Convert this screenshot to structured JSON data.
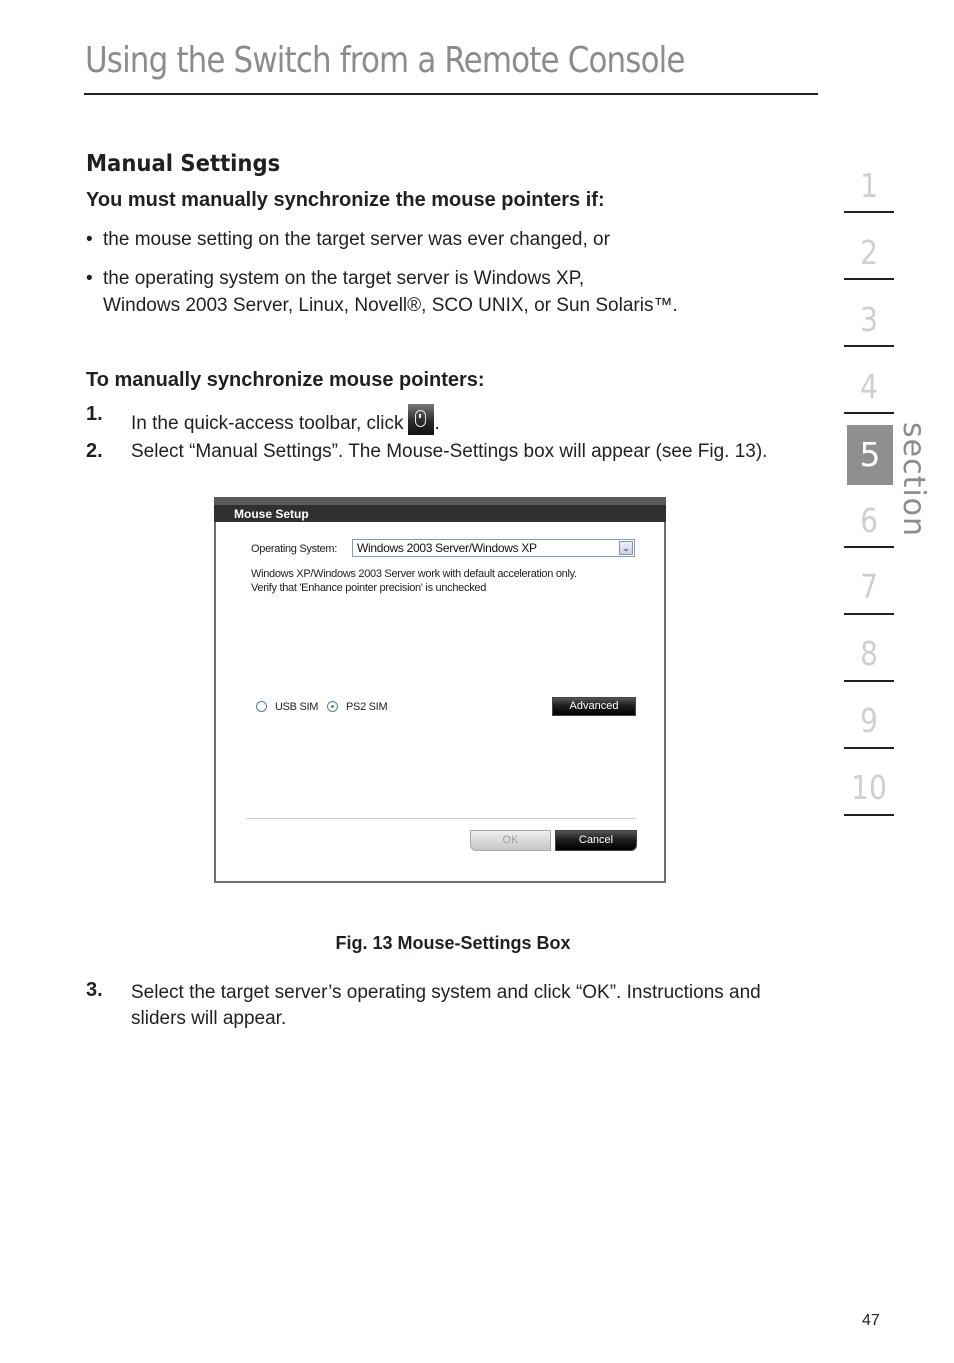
{
  "header": {
    "title": "Using the Switch from a Remote Console"
  },
  "content": {
    "section_heading": "Manual Settings",
    "conditions_heading": "You must manually synchronize the mouse pointers if:",
    "bullets": [
      {
        "lines": [
          "the mouse setting on the target server was ever changed, or"
        ]
      },
      {
        "lines": [
          "the operating system on the target server is Windows XP,",
          "Windows 2003 Server, Linux, Novell®, SCO UNIX, or Sun Solaris™."
        ]
      }
    ],
    "bullet_glyph": "•",
    "procedure_heading": "To manually synchronize mouse pointers:",
    "steps": [
      {
        "number": "1.",
        "text": "In the quick-access toolbar, click",
        "suffix": ".",
        "icon": "mouse-settings-icon"
      },
      {
        "number": "2.",
        "text": "Select “Manual Settings”. The Mouse-Settings box will appear (see Fig. 13)."
      },
      {
        "number": "3.",
        "lines": [
          "Select the target server’s operating system and click “OK”. Instructions and",
          "sliders will appear."
        ]
      }
    ],
    "figure_caption": "Fig. 13 Mouse-Settings Box"
  },
  "dialog": {
    "title": "Mouse Setup",
    "os_label": "Operating System:",
    "os_selected": "Windows 2003 Server/Windows XP",
    "os_dropdown_arrow": "⌄",
    "info_lines": [
      "Windows XP/Windows 2003 Server work with default acceleration only.",
      "Verify that 'Enhance pointer precision' is unchecked"
    ],
    "radio_options": [
      {
        "label": "USB SIM",
        "checked": false
      },
      {
        "label": "PS2 SIM",
        "checked": true
      }
    ],
    "advanced_label": "Advanced",
    "ok_label": "OK",
    "ok_enabled": false,
    "cancel_label": "Cancel"
  },
  "side_nav": {
    "items": [
      "1",
      "2",
      "3",
      "4",
      "5",
      "6",
      "7",
      "8",
      "9",
      "10"
    ],
    "active": "5",
    "label": "section"
  },
  "footer": {
    "page_number": "47"
  }
}
